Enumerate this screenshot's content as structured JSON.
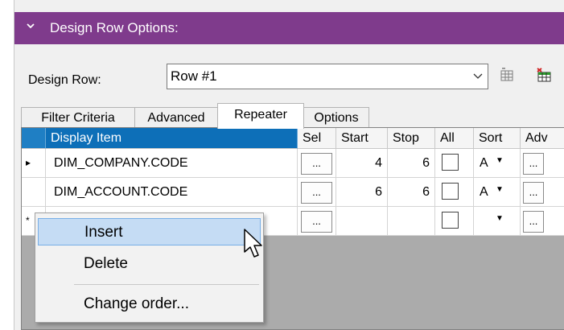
{
  "panel": {
    "title": "Design Row Options:"
  },
  "design_row": {
    "label": "Design Row:",
    "value": "Row #1"
  },
  "tabs": [
    {
      "label": "Filter Criteria",
      "active": false
    },
    {
      "label": "Advanced",
      "active": false
    },
    {
      "label": "Repeater",
      "active": true
    },
    {
      "label": "Options",
      "active": false
    }
  ],
  "grid": {
    "columns": [
      "Display Item",
      "Sel",
      "Start",
      "Stop",
      "All",
      "Sort",
      "Adv"
    ],
    "rows": [
      {
        "marker": "▸",
        "display_item": "DIM_COMPANY.CODE",
        "sel": "...",
        "start": "4",
        "stop": "6",
        "sort": "A",
        "adv": "..."
      },
      {
        "marker": "",
        "display_item": "DIM_ACCOUNT.CODE",
        "sel": "...",
        "start": "6",
        "stop": "6",
        "sort": "A",
        "adv": "..."
      },
      {
        "marker": "*",
        "display_item": "",
        "sel": "...",
        "start": "",
        "stop": "",
        "sort": "",
        "adv": "..."
      }
    ]
  },
  "context_menu": {
    "items": [
      {
        "label": "Insert",
        "highlighted": true
      },
      {
        "label": "Delete",
        "highlighted": false
      },
      {
        "label": "Change order...",
        "highlighted": false
      }
    ]
  },
  "colors": {
    "header_bg": "#7f3b8c",
    "selected_column": "#0d6fb8",
    "menu_highlight": "#c5dcf4"
  },
  "icons": [
    "chevron-down-icon",
    "dropdown-arrow-icon",
    "insert-row-icon",
    "delete-row-icon",
    "sort-dropdown-icon",
    "mouse-pointer-icon"
  ]
}
